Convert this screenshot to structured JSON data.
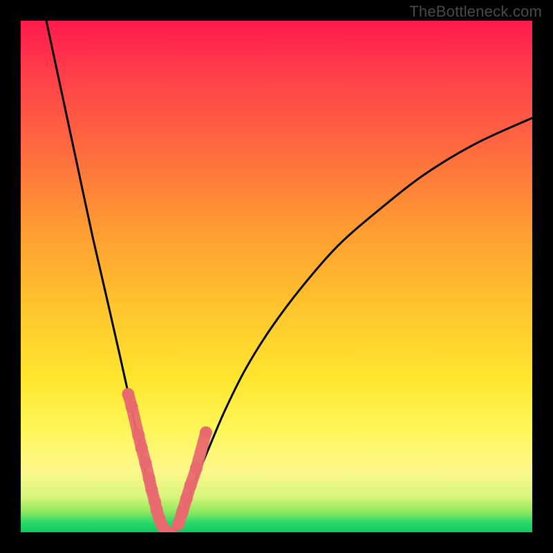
{
  "watermark": "TheBottleneck.com",
  "chart_data": {
    "type": "line",
    "title": "",
    "xlabel": "",
    "ylabel": "",
    "xlim": [
      0,
      100
    ],
    "ylim": [
      0,
      100
    ],
    "grid": false,
    "series": [
      {
        "name": "left-branch",
        "x": [
          5,
          8,
          11,
          14,
          17,
          19.5,
          21.5,
          23,
          24.2,
          25.2,
          25.9,
          26.4,
          26.8,
          27.1,
          27.5
        ],
        "y": [
          100,
          86,
          72,
          58,
          45,
          34,
          25,
          18,
          12.5,
          8.5,
          5.6,
          3.8,
          2.5,
          1.4,
          0
        ]
      },
      {
        "name": "right-branch",
        "x": [
          30,
          31,
          32.5,
          34.5,
          37,
          40,
          44,
          49,
          55,
          62,
          70,
          79,
          89,
          100
        ],
        "y": [
          0,
          2.5,
          6,
          11,
          17,
          24,
          32,
          40,
          48,
          56,
          63,
          70,
          76,
          81
        ]
      },
      {
        "name": "left-branch-markers",
        "x": [
          21.0,
          21.7,
          23.0,
          23.6,
          24.4,
          25.1,
          25.6,
          26.2,
          26.6,
          27.1,
          27.6,
          28.3,
          29.2
        ],
        "y": [
          27,
          24.5,
          19,
          16.5,
          13.5,
          10.5,
          8.3,
          6.0,
          4.3,
          2.7,
          1.4,
          0.4,
          0
        ]
      },
      {
        "name": "right-branch-markers",
        "x": [
          30.8,
          31.6,
          32.4,
          33.2,
          34.3,
          36.2
        ],
        "y": [
          1.6,
          4.0,
          6.6,
          9.2,
          12.5,
          19.5
        ]
      }
    ],
    "colors": {
      "curve": "#000000",
      "marker_fill": "#e86a6f",
      "marker_stroke": "#c9555a"
    }
  }
}
